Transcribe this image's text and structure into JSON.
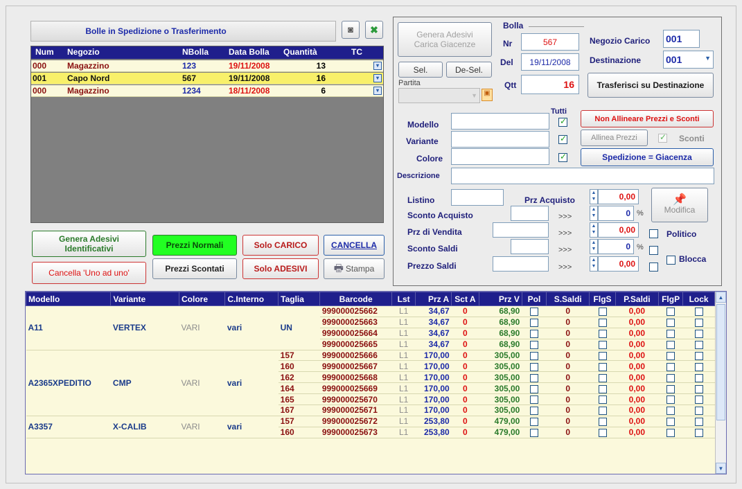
{
  "list_panel": {
    "title": "Bolle in Spedizione o Trasferimento",
    "headers": [
      "Num",
      "Negozio",
      "NBolla",
      "Data Bolla",
      "Quantità",
      "TC"
    ],
    "rows": [
      {
        "num": "000",
        "negozio": "Magazzino",
        "nbolla": "123",
        "data": "19/11/2008",
        "qta": "13"
      },
      {
        "num": "001",
        "negozio": "Capo Nord",
        "nbolla": "567",
        "data": "19/11/2008",
        "qta": "16"
      },
      {
        "num": "000",
        "negozio": "Magazzino",
        "nbolla": "1234",
        "data": "18/11/2008",
        "qta": "6"
      }
    ]
  },
  "buttons": {
    "genera_adesivi_id": "Genera Adesivi Identificativi",
    "cancella_uno": "Cancella 'Uno ad uno'",
    "prezzi_normali": "Prezzi Normali",
    "prezzi_scontati": "Prezzi Scontati",
    "solo_carico": "Solo CARICO",
    "solo_adesivi": "Solo ADESIVI",
    "cancella": "CANCELLA",
    "stampa": "Stampa",
    "genera_adesivi_giacenze": "Genera Adesivi Carica Giacenze",
    "sel": "Sel.",
    "desel": "De-Sel.",
    "trasferisci": "Trasferisci su Destinazione",
    "non_allineare": "Non Allineare Prezzi e Sconti",
    "allinea_prezzi": "Allinea Prezzi",
    "spedizione_giacenza": "Spedizione = Giacenza",
    "modifica": "Modifica"
  },
  "bolla": {
    "title": "Bolla",
    "nr_label": "Nr",
    "nr": "567",
    "del_label": "Del",
    "del": "19/11/2008",
    "qtt_label": "Qtt",
    "qtt": "16",
    "negozio_carico_label": "Negozio Carico",
    "negozio_carico": "001",
    "destinazione_label": "Destinazione",
    "destinazione": "001",
    "partita_label": "Partita"
  },
  "filters": {
    "tutti": "Tutti",
    "modello": "Modello",
    "variante": "Variante",
    "colore": "Colore",
    "descrizione": "Descrizione",
    "sconti": "Sconti"
  },
  "prices": {
    "listino": "Listino",
    "prz_acquisto": "Prz Acquisto",
    "prz_acquisto_val": "0,00",
    "sconto_acquisto": "Sconto Acquisto",
    "sconto_acquisto_val": "0",
    "prz_vendita": "Prz di Vendita",
    "prz_vendita_val": "0,00",
    "sconto_saldi": "Sconto Saldi",
    "sconto_saldi_val": "0",
    "prezzo_saldi": "Prezzo Saldi",
    "prezzo_saldi_val": "0,00",
    "arrows": ">>>",
    "pct": "%",
    "politico": "Politico",
    "blocca": "Blocca"
  },
  "grid": {
    "headers": [
      "Modello",
      "Variante",
      "Colore",
      "C.Interno",
      "Taglia",
      "Barcode",
      "Lst",
      "Prz A",
      "Sct A",
      "Prz V",
      "Pol",
      "S.Saldi",
      "FlgS",
      "P.Saldi",
      "FlgP",
      "Lock"
    ],
    "groups": [
      {
        "modello": "A11",
        "variante": "VERTEX",
        "colore": "VARI",
        "cinterno": "vari",
        "taglia_group": "UN",
        "rows": [
          {
            "taglia": "",
            "barcode": "999000025662",
            "lst": "L1",
            "prza": "34,67",
            "scta": "0",
            "przv": "68,90",
            "ssaldi": "0",
            "psaldi": "0,00"
          },
          {
            "taglia": "",
            "barcode": "999000025663",
            "lst": "L1",
            "prza": "34,67",
            "scta": "0",
            "przv": "68,90",
            "ssaldi": "0",
            "psaldi": "0,00"
          },
          {
            "taglia": "",
            "barcode": "999000025664",
            "lst": "L1",
            "prza": "34,67",
            "scta": "0",
            "przv": "68,90",
            "ssaldi": "0",
            "psaldi": "0,00"
          },
          {
            "taglia": "",
            "barcode": "999000025665",
            "lst": "L1",
            "prza": "34,67",
            "scta": "0",
            "przv": "68,90",
            "ssaldi": "0",
            "psaldi": "0,00"
          }
        ]
      },
      {
        "modello": "A2365XPEDITIO",
        "variante": "CMP",
        "colore": "VARI",
        "cinterno": "vari",
        "taglia_group": "",
        "rows": [
          {
            "taglia": "157",
            "barcode": "999000025666",
            "lst": "L1",
            "prza": "170,00",
            "scta": "0",
            "przv": "305,00",
            "ssaldi": "0",
            "psaldi": "0,00"
          },
          {
            "taglia": "160",
            "barcode": "999000025667",
            "lst": "L1",
            "prza": "170,00",
            "scta": "0",
            "przv": "305,00",
            "ssaldi": "0",
            "psaldi": "0,00"
          },
          {
            "taglia": "162",
            "barcode": "999000025668",
            "lst": "L1",
            "prza": "170,00",
            "scta": "0",
            "przv": "305,00",
            "ssaldi": "0",
            "psaldi": "0,00"
          },
          {
            "taglia": "164",
            "barcode": "999000025669",
            "lst": "L1",
            "prza": "170,00",
            "scta": "0",
            "przv": "305,00",
            "ssaldi": "0",
            "psaldi": "0,00"
          },
          {
            "taglia": "165",
            "barcode": "999000025670",
            "lst": "L1",
            "prza": "170,00",
            "scta": "0",
            "przv": "305,00",
            "ssaldi": "0",
            "psaldi": "0,00"
          },
          {
            "taglia": "167",
            "barcode": "999000025671",
            "lst": "L1",
            "prza": "170,00",
            "scta": "0",
            "przv": "305,00",
            "ssaldi": "0",
            "psaldi": "0,00"
          }
        ]
      },
      {
        "modello": "A3357",
        "variante": "X-CALIB",
        "colore": "VARI",
        "cinterno": "vari",
        "taglia_group": "",
        "rows": [
          {
            "taglia": "157",
            "barcode": "999000025672",
            "lst": "L1",
            "prza": "253,80",
            "scta": "0",
            "przv": "479,00",
            "ssaldi": "0",
            "psaldi": "0,00"
          },
          {
            "taglia": "160",
            "barcode": "999000025673",
            "lst": "L1",
            "prza": "253,80",
            "scta": "0",
            "przv": "479,00",
            "ssaldi": "0",
            "psaldi": "0,00"
          }
        ]
      }
    ]
  }
}
